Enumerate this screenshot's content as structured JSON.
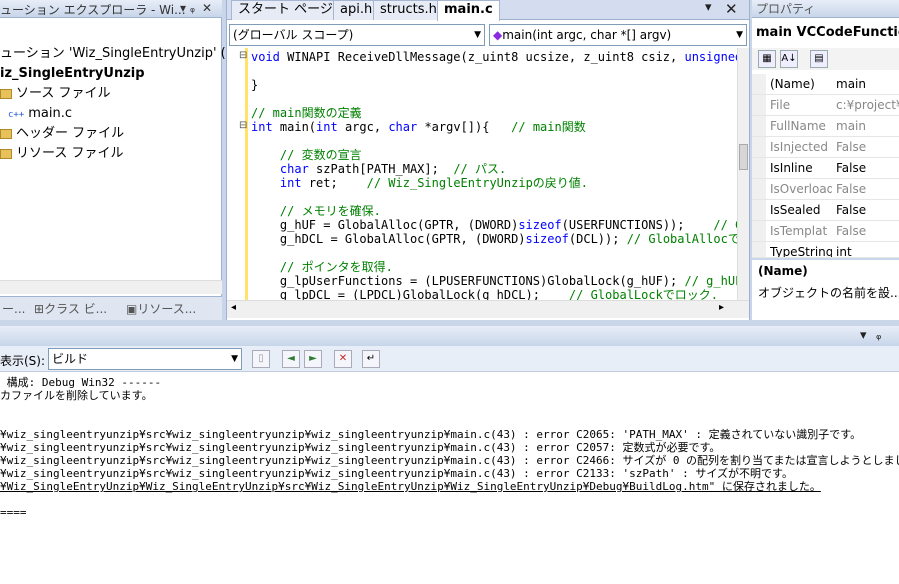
{
  "solution_explorer": {
    "title": "ューション エクスプローラ - Wi...",
    "solution_label": "ューション 'Wiz_SingleEntryUnzip' (1 プ",
    "project": "iz_SingleEntryUnzip",
    "items": [
      {
        "label": "ソース ファイル"
      },
      {
        "label": "main.c"
      },
      {
        "label": "ヘッダー ファイル"
      },
      {
        "label": "リソース ファイル"
      }
    ],
    "tabs": [
      "ー...",
      "クラス ビ...",
      "リソース..."
    ]
  },
  "editor": {
    "tabs": [
      "スタート ページ",
      "api.h",
      "structs.h",
      "main.c"
    ],
    "active_tab": "main.c",
    "scope_combo": "(グローバル スコープ)",
    "function_combo": "main(int argc, char *[] argv)",
    "lines": [
      "void WINAPI ReceiveDllMessage(z_uint8 ucsize, z_uint8 csiz, unsigned",
      "",
      "}",
      "",
      "// main関数の定義",
      "int main(int argc, char *argv[]){   // main関数",
      "",
      "    // 変数の宣言",
      "    char szPath[PATH_MAX];  // パス.",
      "    int ret;    // Wiz_SingleEntryUnzipの戻り値.",
      "",
      "    // メモリを確保.",
      "    g_hUF = GlobalAlloc(GPTR, (DWORD)sizeof(USERFUNCTIONS));    // G",
      "    g_hDCL = GlobalAlloc(GPTR, (DWORD)sizeof(DCL)); // GlobalAllocでメ",
      "",
      "    // ポインタを取得.",
      "    g_lpUserFunctions = (LPUSERFUNCTIONS)GlobalLock(g_hUF); // g_hUF",
      "    g_lpDCL = (LPDCL)GlobalLock(g_hDCL);    // GlobalLockでロック."
    ]
  },
  "properties": {
    "title": "プロパティ",
    "object": "main VCCodeFunction",
    "rows": [
      {
        "name": "(Name)",
        "value": "main"
      },
      {
        "name": "File",
        "value": "c:¥project¥"
      },
      {
        "name": "FullName",
        "value": "main"
      },
      {
        "name": "IsInjected",
        "value": "False"
      },
      {
        "name": "IsInline",
        "value": "False"
      },
      {
        "name": "IsOverload",
        "value": "False"
      },
      {
        "name": "IsSealed",
        "value": "False"
      },
      {
        "name": "IsTemplat",
        "value": "False"
      },
      {
        "name": "TypeString",
        "value": "int"
      }
    ],
    "desc_title": "(Name)",
    "desc_text": "オブジェクトの名前を設..."
  },
  "output": {
    "show_label": "表示(S):",
    "show_value": "ビルド",
    "lines": [
      " 構成: Debug Win32 ------",
      "カファイルを削除しています。",
      "",
      "",
      "",
      "¥wiz_singleentryunzip¥src¥wiz_singleentryunzip¥wiz_singleentryunzip¥main.c(43) : error C2065: 'PATH_MAX' : 定義されていない識別子です。",
      "¥wiz_singleentryunzip¥src¥wiz_singleentryunzip¥wiz_singleentryunzip¥main.c(43) : error C2057: 定数式が必要です。",
      "¥wiz_singleentryunzip¥src¥wiz_singleentryunzip¥wiz_singleentryunzip¥main.c(43) : error C2466: サイズが 0 の配列を割り当てまたは宣言しようとしました。",
      "¥wiz_singleentryunzip¥src¥wiz_singleentryunzip¥wiz_singleentryunzip¥main.c(43) : error C2133: 'szPath' : サイズが不明です。",
      "¥Wiz_SingleEntryUnzip¥Wiz_SingleEntryUnzip¥src¥Wiz_SingleEntryUnzip¥Wiz_SingleEntryUnzip¥Debug¥BuildLog.htm\" に保存されました。",
      "",
      "",
      "===="
    ]
  }
}
